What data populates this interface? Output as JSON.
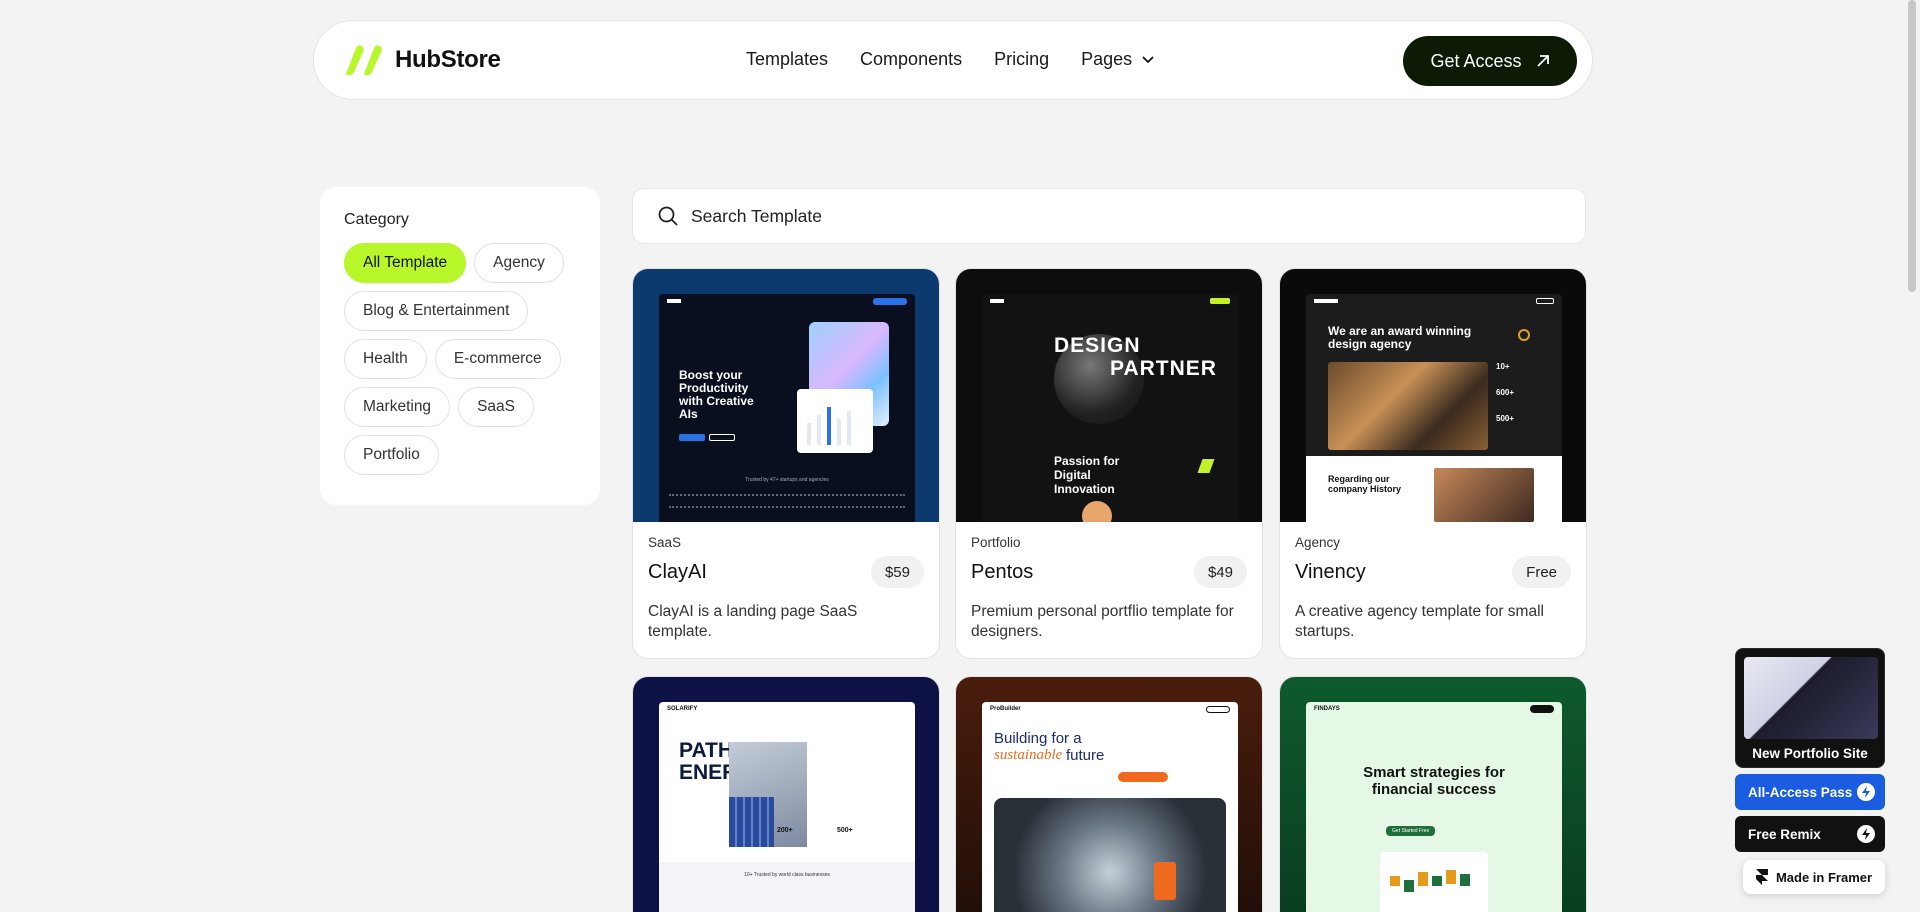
{
  "header": {
    "brand": "HubStore",
    "nav": [
      "Templates",
      "Components",
      "Pricing",
      "Pages"
    ],
    "cta": "Get Access"
  },
  "sidebar": {
    "title": "Category",
    "chips": [
      "All Template",
      "Agency",
      "Blog & Entertainment",
      "Health",
      "E-commerce",
      "Marketing",
      "SaaS",
      "Portfolio"
    ],
    "active": "All Template"
  },
  "search": {
    "placeholder": "Search Template"
  },
  "cards": [
    {
      "category": "SaaS",
      "name": "ClayAI",
      "price": "$59",
      "description": "ClayAI is a landing page SaaS template.",
      "preview": {
        "headline": "Boost your Productivity with Creative AIs",
        "trusted": "Trusted by 47+ startups and agencies"
      }
    },
    {
      "category": "Portfolio",
      "name": "Pentos",
      "price": "$49",
      "description": "Premium personal portflio template for designers.",
      "preview": {
        "headline1": "DESIGN",
        "headline2": "PARTNER",
        "sub": "Passion for Digital Innovation"
      }
    },
    {
      "category": "Agency",
      "name": "Vinency",
      "price": "Free",
      "description": "A creative agency template for small startups.",
      "preview": {
        "headline": "We are an award winning design agency",
        "stats": [
          "10+",
          "600+",
          "500+"
        ],
        "history": "Regarding our company History"
      }
    },
    {
      "preview": {
        "brand": "SOLARIFY",
        "headline": "PATH TO ENERGY.",
        "stats": [
          "200+",
          "500+"
        ],
        "trusted": "10+ Trusted by world class businesses"
      }
    },
    {
      "preview": {
        "brand": "ProBuilder",
        "headline1": "Building for a",
        "headline2": "sustainable",
        "headline3": "future"
      }
    },
    {
      "preview": {
        "brand": "FINDAYS",
        "headline": "Smart strategies for financial success",
        "cta": "Get Started Free"
      }
    }
  ],
  "framer": {
    "promo": "New Portfolio Site",
    "all_access": "All-Access Pass",
    "remix": "Free Remix",
    "made_in": "Made in Framer"
  },
  "colors": {
    "accent": "#b8f72a",
    "dark": "#0d1a06",
    "blue_pass": "#1a5de0"
  }
}
